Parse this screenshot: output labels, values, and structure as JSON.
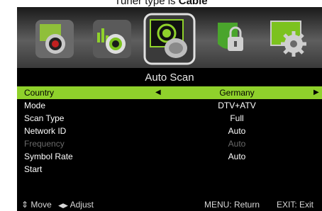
{
  "caption": {
    "prefix": "Tuner type is ",
    "bold": "Cable"
  },
  "menu_icons": [
    {
      "name": "picture-icon",
      "selected": false
    },
    {
      "name": "sound-icon",
      "selected": false
    },
    {
      "name": "channel-icon",
      "selected": true
    },
    {
      "name": "lock-icon",
      "selected": false
    },
    {
      "name": "setup-icon",
      "selected": false
    }
  ],
  "title": "Auto Scan",
  "rows": [
    {
      "label": "Country",
      "value": "Germany"
    },
    {
      "label": "Mode",
      "value": "DTV+ATV"
    },
    {
      "label": "Scan Type",
      "value": "Full"
    },
    {
      "label": "Network ID",
      "value": "Auto"
    },
    {
      "label": "Frequency",
      "value": "Auto"
    },
    {
      "label": "Symbol Rate",
      "value": "Auto"
    },
    {
      "label": "Start",
      "value": ""
    }
  ],
  "colors": {
    "highlight": "#8fd12b",
    "disabled": "#6a6a6a"
  },
  "footer": {
    "move": "Move",
    "adjust": "Adjust",
    "menu_return": "MENU: Return",
    "exit": "EXIT: Exit"
  }
}
